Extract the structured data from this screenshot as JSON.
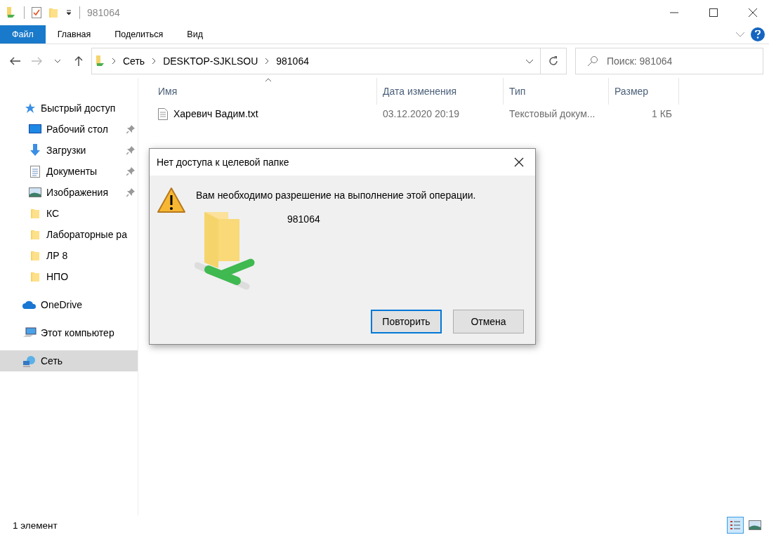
{
  "window": {
    "title": "981064"
  },
  "ribbon_tabs": [
    {
      "label": "Файл",
      "kind": "file"
    },
    {
      "label": "Главная",
      "kind": "tab"
    },
    {
      "label": "Поделиться",
      "kind": "tab"
    },
    {
      "label": "Вид",
      "kind": "tab"
    }
  ],
  "address_bar": {
    "path": [
      "Сеть",
      "DESKTOP-SJKLSOU",
      "981064"
    ]
  },
  "search": {
    "placeholder": "Поиск: 981064"
  },
  "sidebar": {
    "items": [
      {
        "label": "Быстрый доступ",
        "kind": "star",
        "selected": false,
        "children": [
          {
            "label": "Рабочий стол",
            "kind": "desktop",
            "pinned": true,
            "selected": false
          },
          {
            "label": "Загрузки",
            "kind": "download",
            "pinned": true,
            "selected": false
          },
          {
            "label": "Документы",
            "kind": "document",
            "pinned": true,
            "selected": false
          },
          {
            "label": "Изображения",
            "kind": "picture",
            "pinned": true,
            "selected": false
          },
          {
            "label": "КС",
            "kind": "folder",
            "pinned": false,
            "selected": false
          },
          {
            "label": "Лабораторные ра",
            "kind": "folder",
            "pinned": false,
            "selected": false
          },
          {
            "label": "ЛР 8",
            "kind": "folder",
            "pinned": false,
            "selected": false
          },
          {
            "label": "НПО",
            "kind": "folder",
            "pinned": false,
            "selected": false
          }
        ]
      },
      {
        "label": "OneDrive",
        "kind": "cloud",
        "selected": false
      },
      {
        "label": "Этот компьютер",
        "kind": "computer",
        "selected": false
      },
      {
        "label": "Сеть",
        "kind": "network",
        "selected": true
      }
    ]
  },
  "table": {
    "columns": [
      {
        "label": "Имя",
        "sorted": true
      },
      {
        "label": "Дата изменения",
        "sorted": false
      },
      {
        "label": "Тип",
        "sorted": false
      },
      {
        "label": "Размер",
        "sorted": false
      }
    ],
    "rows": [
      {
        "name": "Харевич Вадим.txt",
        "date": "03.12.2020 20:19",
        "type": "Текстовый докум...",
        "size": "1 КБ"
      }
    ]
  },
  "dialog": {
    "title": "Нет доступа к целевой папке",
    "message": "Вам необходимо разрешение на выполнение этой операции.",
    "item": "981064",
    "buttons": [
      {
        "label": "Повторить",
        "default": true
      },
      {
        "label": "Отмена",
        "default": false
      }
    ]
  },
  "status_bar": {
    "text": "1 элемент",
    "views": [
      {
        "kind": "details",
        "selected": true
      },
      {
        "kind": "large",
        "selected": false
      }
    ]
  }
}
